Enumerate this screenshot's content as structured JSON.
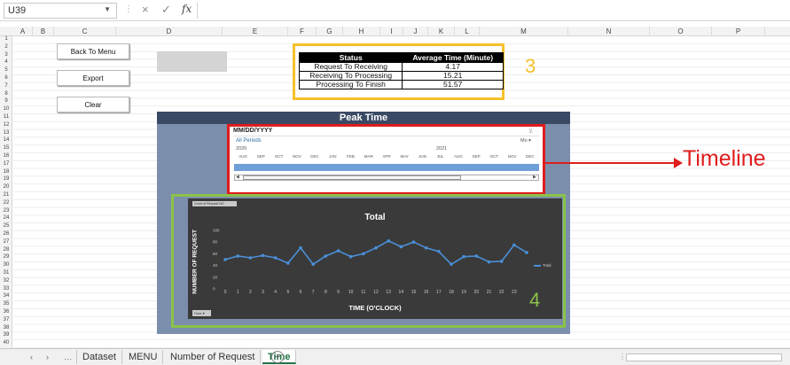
{
  "formula_bar": {
    "cell_ref": "U39",
    "cancel_icon": "×",
    "enter_icon": "✓",
    "fx_label": "fx",
    "formula": ""
  },
  "columns": [
    "A",
    "B",
    "C",
    "D",
    "E",
    "F",
    "G",
    "H",
    "I",
    "J",
    "K",
    "L",
    "M",
    "N",
    "O",
    "P"
  ],
  "rows": [
    "1",
    "2",
    "3",
    "4",
    "5",
    "6",
    "7",
    "8",
    "9",
    "10",
    "11",
    "12",
    "13",
    "14",
    "15",
    "16",
    "17",
    "18",
    "19",
    "20",
    "21",
    "22",
    "23",
    "24",
    "25",
    "26",
    "27",
    "28",
    "29",
    "30",
    "31",
    "32",
    "33",
    "34",
    "35",
    "36",
    "37",
    "38",
    "39",
    "40"
  ],
  "buttons": {
    "back_to_menu": "Back To Menu",
    "export": "Export",
    "clear": "Clear"
  },
  "status_table": {
    "headers": [
      "Status",
      "Average Time (Minute)"
    ],
    "rows": [
      [
        "Request To Receiving",
        "4.17"
      ],
      [
        "Receiving To Processing",
        "15.21"
      ],
      [
        "Processing To Finish",
        "51.57"
      ]
    ]
  },
  "annotations": {
    "status_number": "3",
    "chart_number": "4",
    "timeline_label": "Timeline"
  },
  "peak_panel": {
    "title": "Peak Time"
  },
  "timeline": {
    "date_format": "MM/DD/YYYY",
    "all_periods": "All Periods",
    "level": "Mo",
    "years": [
      "2020",
      "2021"
    ],
    "months": [
      "AUG",
      "SEP",
      "OCT",
      "NOV",
      "DEC",
      "JAN",
      "FEB",
      "MAR",
      "APR",
      "MAY",
      "JUN",
      "JUL",
      "AUG",
      "SEP",
      "OCT",
      "NOV",
      "DEC"
    ]
  },
  "chart_data": {
    "type": "line",
    "field_button": "Count of Request NO.",
    "hour_button": "Hour",
    "title": "Total",
    "xlabel": "TIME (O'CLOCK)",
    "ylabel": "NUMBER OF REQUEST",
    "ylim": [
      0,
      100
    ],
    "yticks": [
      0,
      20,
      40,
      60,
      80,
      100
    ],
    "x": [
      "0",
      "1",
      "2",
      "3",
      "4",
      "5",
      "6",
      "7",
      "8",
      "9",
      "10",
      "11",
      "12",
      "13",
      "14",
      "15",
      "16",
      "17",
      "18",
      "19",
      "20",
      "21",
      "22",
      "23"
    ],
    "series": [
      {
        "name": "Total",
        "values": [
          50,
          56,
          53,
          57,
          53,
          44,
          70,
          42,
          56,
          65,
          55,
          60,
          70,
          82,
          72,
          80,
          70,
          64,
          42,
          55,
          56,
          46,
          47,
          75,
          62
        ]
      }
    ],
    "color": "#4a90d9",
    "legend": "right"
  },
  "sheet_tabs": {
    "tabs": [
      "Dataset",
      "MENU",
      "Number of Request",
      "Time"
    ],
    "active": "Time",
    "add": "+"
  }
}
